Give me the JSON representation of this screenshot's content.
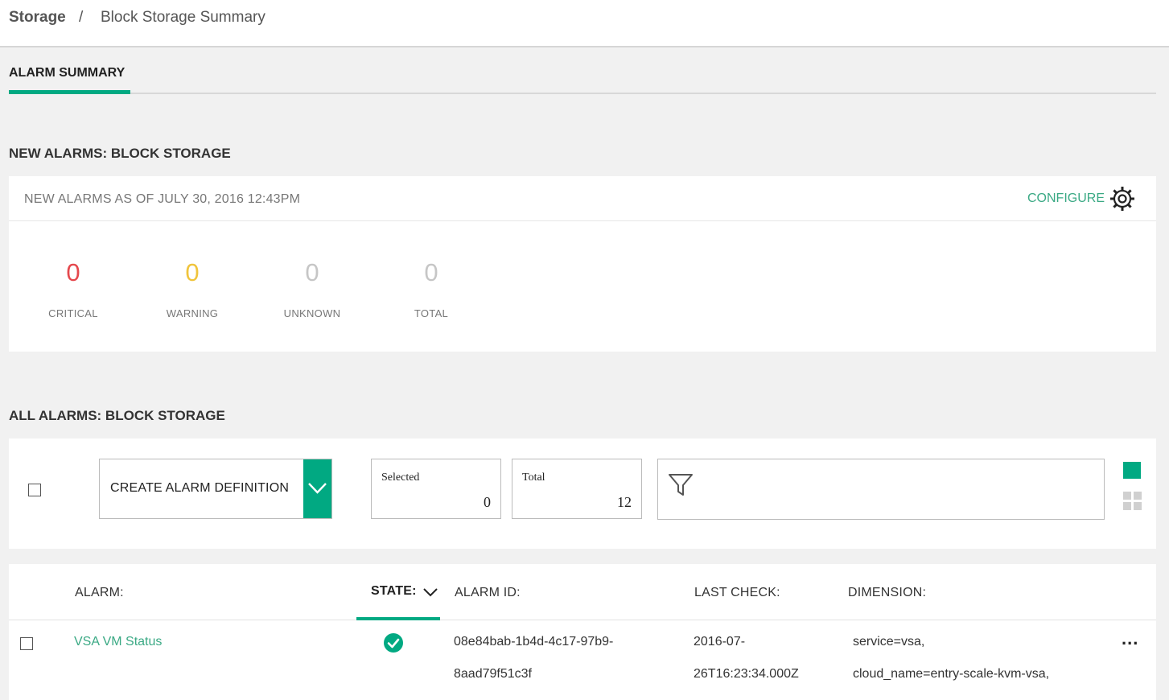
{
  "breadcrumb": {
    "root": "Storage",
    "separator": "/",
    "current": "Block Storage Summary"
  },
  "tabs": [
    {
      "label": "ALARM SUMMARY",
      "active": true
    }
  ],
  "new_alarms": {
    "section_title": "NEW ALARMS: BLOCK STORAGE",
    "as_of": "NEW ALARMS AS OF JULY 30, 2016 12:43PM",
    "configure_label": "CONFIGURE",
    "counters": [
      {
        "value": "0",
        "label": "CRITICAL",
        "color": "#e5484d"
      },
      {
        "value": "0",
        "label": "WARNING",
        "color": "#f0c43c"
      },
      {
        "value": "0",
        "label": "UNKNOWN",
        "color": "#c6c6c6"
      },
      {
        "value": "0",
        "label": "TOTAL",
        "color": "#c6c6c6"
      }
    ]
  },
  "all_alarms": {
    "section_title": "ALL ALARMS: BLOCK STORAGE",
    "create_label": "CREATE ALARM DEFINITION",
    "selected": {
      "label": "Selected",
      "value": "0"
    },
    "total": {
      "label": "Total",
      "value": "12"
    },
    "filter_placeholder": ""
  },
  "table": {
    "columns": [
      "ALARM:",
      "STATE:",
      "ALARM ID:",
      "LAST CHECK:",
      "DIMENSION:"
    ],
    "rows": [
      {
        "alarm": "VSA VM Status",
        "state": "ok",
        "alarm_id_line1": "08e84bab-1b4d-4c17-97b9-",
        "alarm_id_line2": "8aad79f51c3f",
        "last_check_line1": "2016-07-",
        "last_check_line2": "26T16:23:34.000Z",
        "dimension_line1": "service=vsa,",
        "dimension_line2": "cloud_name=entry-scale-kvm-vsa,",
        "more_label": "..."
      }
    ]
  },
  "colors": {
    "accent": "#01a982",
    "link": "#3aa984"
  }
}
